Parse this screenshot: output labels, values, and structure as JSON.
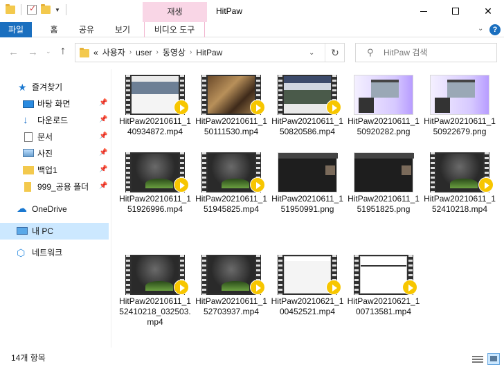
{
  "window": {
    "title": "HitPaw",
    "context_tab": "재생",
    "controls": {
      "minimize": "—",
      "maximize": "☐",
      "close": "✕"
    }
  },
  "ribbon": {
    "tabs": [
      "파일",
      "홈",
      "공유",
      "보기",
      "비디오 도구"
    ],
    "help": "?"
  },
  "address": {
    "overflow": "«",
    "crumbs": [
      "사용자",
      "user",
      "동영상",
      "HitPaw"
    ]
  },
  "search": {
    "placeholder": "HitPaw 검색"
  },
  "sidebar": {
    "items": [
      {
        "label": "즐겨찾기",
        "icon": "star-icon",
        "pinned": false
      },
      {
        "label": "바탕 화면",
        "icon": "desktop-icon",
        "pinned": true
      },
      {
        "label": "다운로드",
        "icon": "download-icon",
        "pinned": true
      },
      {
        "label": "문서",
        "icon": "document-icon",
        "pinned": true
      },
      {
        "label": "사진",
        "icon": "pictures-icon",
        "pinned": true
      },
      {
        "label": "백업1",
        "icon": "folder-icon",
        "pinned": true
      },
      {
        "label": "999_공용 폴더",
        "icon": "folder-icon",
        "pinned": true
      },
      {
        "label": "OneDrive",
        "icon": "cloud-icon",
        "pinned": false
      },
      {
        "label": "내 PC",
        "icon": "pc-icon",
        "pinned": false,
        "selected": true
      },
      {
        "label": "네트워크",
        "icon": "network-icon",
        "pinned": false
      }
    ]
  },
  "files": [
    {
      "name": "HitPaw20210611_140934872.mp4",
      "type": "video",
      "thumb": "web"
    },
    {
      "name": "HitPaw20210611_150111530.mp4",
      "type": "video",
      "thumb": "photo"
    },
    {
      "name": "HitPaw20210611_150820586.mp4",
      "type": "video",
      "thumb": "mtn"
    },
    {
      "name": "HitPaw20210611_150920282.png",
      "type": "image",
      "thumb": "purple"
    },
    {
      "name": "HitPaw20210611_150922679.png",
      "type": "image",
      "thumb": "purple"
    },
    {
      "name": "HitPaw20210611_151926996.mp4",
      "type": "video",
      "thumb": "dark"
    },
    {
      "name": "HitPaw20210611_151945825.mp4",
      "type": "video",
      "thumb": "dark"
    },
    {
      "name": "HitPaw20210611_151950991.png",
      "type": "image",
      "thumb": "darkimg"
    },
    {
      "name": "HitPaw20210611_151951825.png",
      "type": "image",
      "thumb": "darkimg"
    },
    {
      "name": "HitPaw20210611_152410218.mp4",
      "type": "video",
      "thumb": "dark"
    },
    {
      "name": "HitPaw20210611_152410218_032503.mp4",
      "type": "video",
      "thumb": "dark"
    },
    {
      "name": "HitPaw20210611_152703937.mp4",
      "type": "video",
      "thumb": "dark"
    },
    {
      "name": "HitPaw20210621_100452521.mp4",
      "type": "video",
      "thumb": "doc"
    },
    {
      "name": "HitPaw20210621_100713581.mp4",
      "type": "video",
      "thumb": "doc2"
    }
  ],
  "status": {
    "count": "14개 항목"
  },
  "colors": {
    "accent": "#1a6fbf",
    "context_tab": "#f9d6e6",
    "play_badge": "#f7c600",
    "selected": "#cce8ff"
  }
}
